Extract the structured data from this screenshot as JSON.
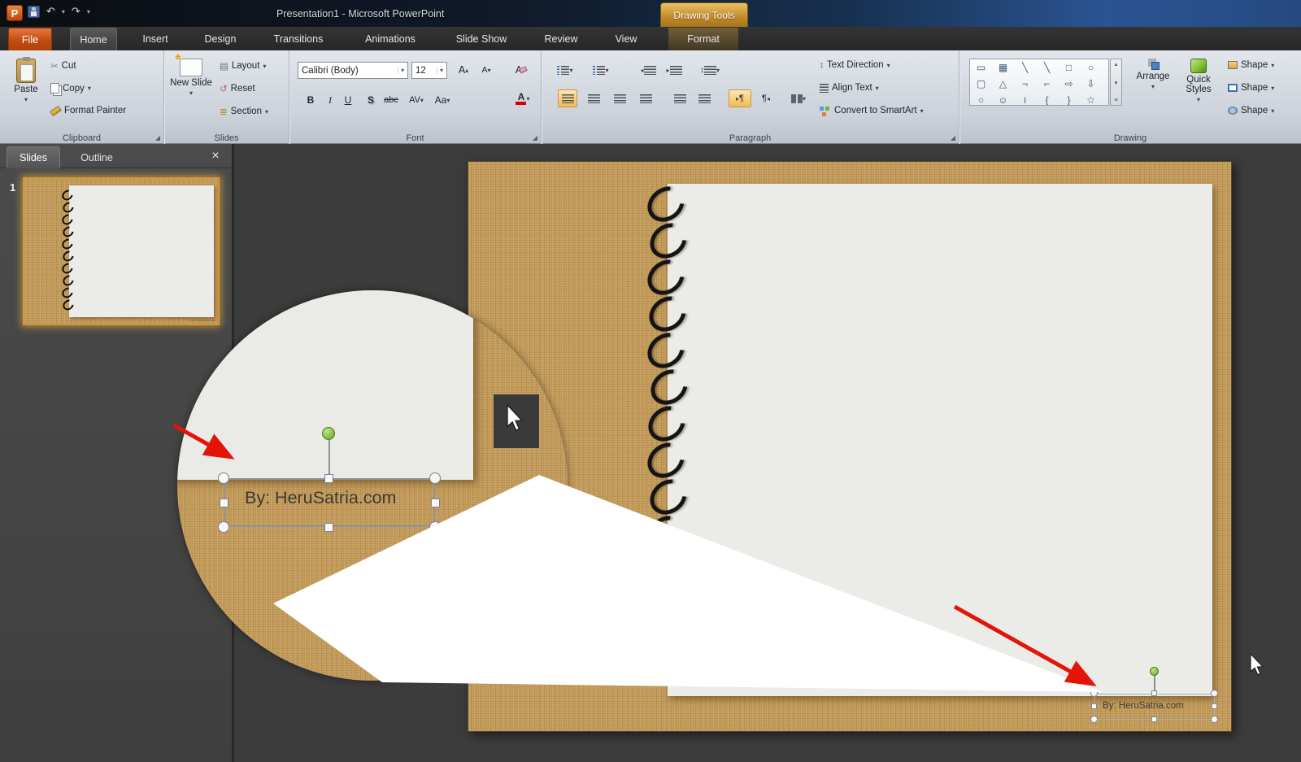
{
  "titlebar": {
    "app_initial": "P",
    "title": "Presentation1 - Microsoft PowerPoint",
    "contextual_group": "Drawing Tools"
  },
  "glyphs": {
    "dropdown": "▾",
    "up_small": "▴",
    "down_small": "▾",
    "cut": "✂",
    "undo": "↶",
    "redo": "↷",
    "reset": "↺",
    "layout": "▤",
    "section": "≣",
    "tri_left": "◂",
    "tri_right": "▸",
    "updown": "↕",
    "pilcrow": "¶",
    "launcher": "◢",
    "gallery_more": "≡"
  },
  "tabs": {
    "file": "File",
    "home": "Home",
    "insert": "Insert",
    "design": "Design",
    "transitions": "Transitions",
    "animations": "Animations",
    "slideshow": "Slide Show",
    "review": "Review",
    "view": "View",
    "format": "Format"
  },
  "clipboard": {
    "group_label": "Clipboard",
    "paste": "Paste",
    "cut": "Cut",
    "copy": "Copy",
    "format_painter": "Format Painter"
  },
  "slides_group": {
    "group_label": "Slides",
    "new_slide": "New Slide",
    "layout": "Layout",
    "reset": "Reset",
    "section": "Section"
  },
  "font_group": {
    "group_label": "Font",
    "font_name": "Calibri (Body)",
    "font_size": "12",
    "bold": "B",
    "italic": "I",
    "underline": "U",
    "shadow": "S",
    "strike": "abc",
    "spacing": "AV",
    "case": "Aa",
    "color": "A",
    "grow": "A",
    "shrink": "A"
  },
  "paragraph_group": {
    "group_label": "Paragraph",
    "text_direction": "Text Direction",
    "align_text": "Align Text",
    "convert_smartart": "Convert to SmartArt"
  },
  "drawing_group": {
    "group_label": "Drawing",
    "arrange": "Arrange",
    "quick_styles": "Quick Styles",
    "shape_fill": "Shape",
    "shape_outline": "Shape",
    "shape_effects": "Shape",
    "shapes_row1": [
      "▭",
      "▦",
      "╲",
      "╲",
      "□",
      "○"
    ],
    "shapes_row2": [
      "▢",
      "△",
      "¬",
      "⌐",
      "⇨",
      "⇩"
    ],
    "shapes_row3": [
      "○",
      "☺",
      "≀",
      "{",
      "}",
      "☆"
    ]
  },
  "sidebar": {
    "tab_slides": "Slides",
    "tab_outline": "Outline",
    "close": "×",
    "slide_number": "1"
  },
  "slide": {
    "credit": "By: HeruSatria.com"
  },
  "magnifier": {
    "credit": "By: HeruSatria.com"
  },
  "thumbnail": {
    "credit": "By: HeruSatria.com"
  }
}
